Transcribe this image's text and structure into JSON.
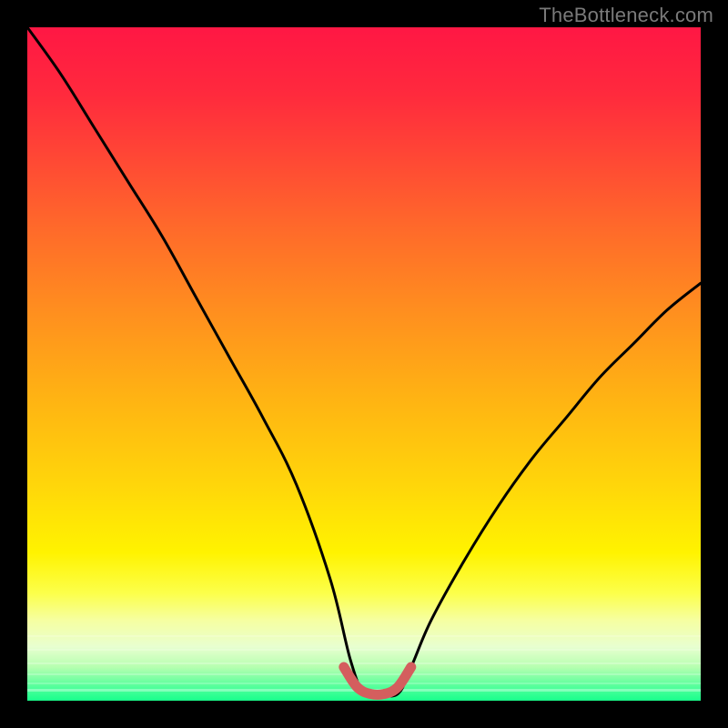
{
  "watermark": "TheBottleneck.com",
  "colors": {
    "curve": "#000000",
    "optimal_band": "#d45e5e",
    "frame": "#000000"
  },
  "chart_data": {
    "type": "line",
    "title": "",
    "xlabel": "",
    "ylabel": "",
    "xlim": [
      0,
      100
    ],
    "ylim": [
      0,
      100
    ],
    "grid": false,
    "series": [
      {
        "name": "bottleneck-curve",
        "x": [
          0,
          5,
          10,
          15,
          20,
          25,
          30,
          35,
          40,
          45,
          48,
          50,
          52,
          55,
          57,
          60,
          65,
          70,
          75,
          80,
          85,
          90,
          95,
          100
        ],
        "y": [
          100,
          93,
          85,
          77,
          69,
          60,
          51,
          42,
          32,
          18,
          6,
          1,
          1,
          1,
          5,
          12,
          21,
          29,
          36,
          42,
          48,
          53,
          58,
          62
        ]
      },
      {
        "name": "optimal-band",
        "x": [
          47,
          49,
          51,
          53,
          55,
          57
        ],
        "y": [
          5,
          2,
          1,
          1,
          2,
          5
        ]
      }
    ],
    "annotations": []
  }
}
